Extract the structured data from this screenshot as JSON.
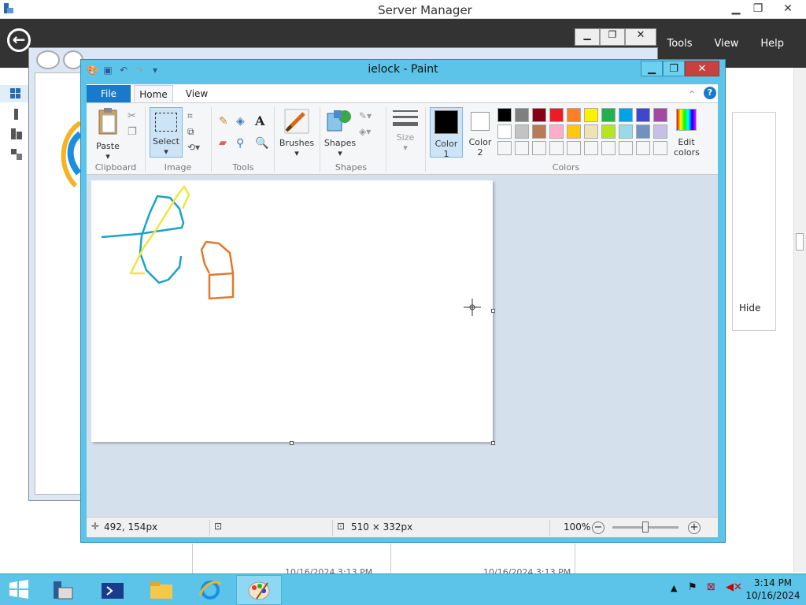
{
  "server_manager": {
    "title": "Server Manager",
    "menu": [
      "Tools",
      "View",
      "Help"
    ],
    "panel_button": "Hide",
    "timestamps": [
      "10/16/2024 3:13 PM",
      "10/16/2024 3:13 PM"
    ]
  },
  "paint": {
    "title": "ielock - Paint",
    "tabs": {
      "file": "File",
      "home": "Home",
      "view": "View"
    },
    "groups": {
      "clipboard": "Clipboard",
      "image": "Image",
      "tools": "Tools",
      "shapes": "Shapes",
      "colors": "Colors"
    },
    "buttons": {
      "paste": "Paste",
      "select": "Select",
      "brushes": "Brushes",
      "shapes": "Shapes",
      "size": "Size",
      "color1_line1": "Color",
      "color1_line2": "1",
      "color2_line1": "Color",
      "color2_line2": "2",
      "edit_colors_line1": "Edit",
      "edit_colors_line2": "colors"
    },
    "palette_row1": [
      "#000000",
      "#7f7f7f",
      "#880015",
      "#ed1c24",
      "#ff7f27",
      "#fff200",
      "#22b14c",
      "#00a2e8",
      "#3f48cc",
      "#a349a4"
    ],
    "palette_row2": [
      "#ffffff",
      "#c3c3c3",
      "#b97a57",
      "#ffaec9",
      "#ffc90e",
      "#efe4b0",
      "#b5e61d",
      "#99d9ea",
      "#7092be",
      "#c8bfe7"
    ],
    "color1": "#000000",
    "color2": "#ffffff",
    "status": {
      "position": "492, 154px",
      "selection": "",
      "size": "510 × 332px",
      "zoom": "100%"
    }
  },
  "taskbar": {
    "time": "3:14 PM",
    "date": "10/16/2024"
  }
}
